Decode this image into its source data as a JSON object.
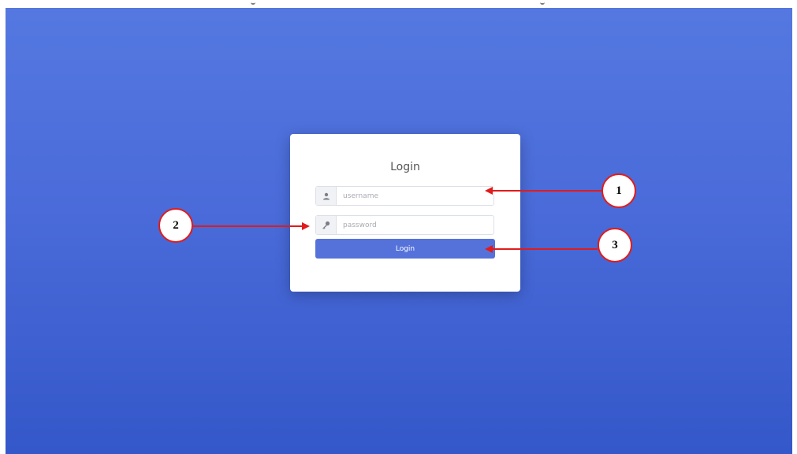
{
  "login_card": {
    "title": "Login",
    "username_placeholder": "username",
    "password_placeholder": "password",
    "login_button_label": "Login"
  },
  "icons": {
    "username_prefix": "user-icon",
    "password_prefix": "key-icon"
  },
  "annotations": {
    "callout_1": "1",
    "callout_2": "2",
    "callout_3": "3",
    "arrow_color": "#e11b1b"
  },
  "colors": {
    "background_top": "#5478e0",
    "background_bottom": "#3457c9",
    "button": "#5572db"
  }
}
